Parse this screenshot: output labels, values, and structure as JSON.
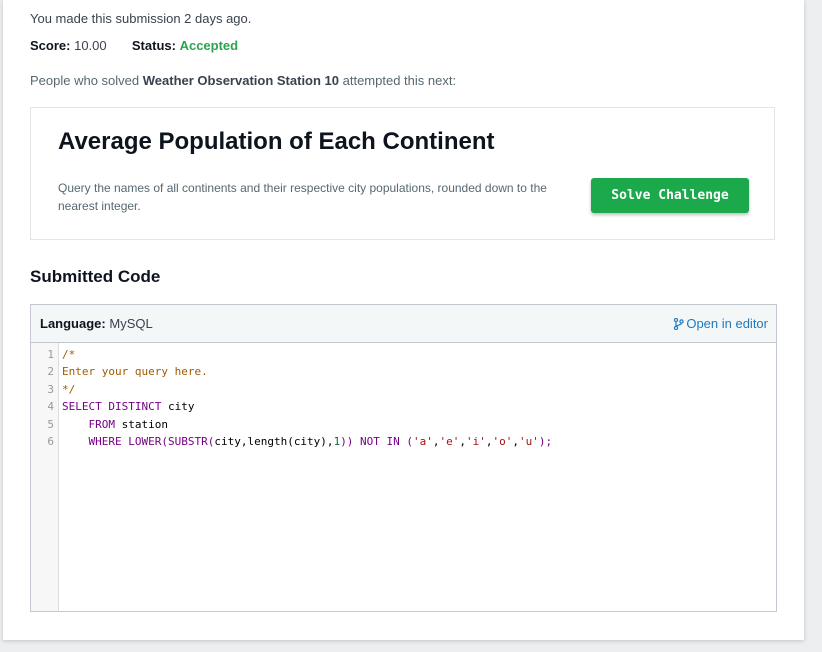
{
  "submission": {
    "made_ago": "You made this submission 2 days ago.",
    "score_label": "Score:",
    "score_value": "10.00",
    "status_label": "Status:",
    "status_value": "Accepted",
    "next_prefix": "People who solved ",
    "solved_challenge": "Weather Observation Station 10",
    "next_suffix": " attempted this next:"
  },
  "recommended": {
    "title": "Average Population of Each Continent",
    "description": "Query the names of all continents and their respective city populations, rounded down to the nearest integer.",
    "button_label": "Solve Challenge"
  },
  "code_section": {
    "heading": "Submitted Code",
    "language_label": "Language:",
    "language_value": "MySQL",
    "open_editor_label": "Open in editor",
    "line_numbers": [
      "1",
      "2",
      "3",
      "4",
      "5",
      "6"
    ],
    "lines": {
      "l1": "/*",
      "l2": "Enter your query here.",
      "l3": "*/",
      "l4_kw": "SELECT DISTINCT",
      "l4_rest": " city",
      "l5_indent": "    ",
      "l5_kw": "FROM",
      "l5_rest": " station",
      "l6_indent": "    ",
      "l6_kw1": "WHERE LOWER(SUBSTR(",
      "l6_a": "city,length(city),",
      "l6_num": "1",
      "l6_kw2": ")) NOT IN (",
      "l6_s1": "'a'",
      "l6_c1": ",",
      "l6_s2": "'e'",
      "l6_c2": ",",
      "l6_s3": "'i'",
      "l6_c3": ",",
      "l6_s4": "'o'",
      "l6_c4": ",",
      "l6_s5": "'u'",
      "l6_end": ");"
    }
  },
  "colors": {
    "accent_green": "#1ba94c",
    "accepted_green": "#2ea34f",
    "link_blue": "#1f7abf"
  },
  "icons": {
    "open_editor": "git-branch-icon"
  }
}
